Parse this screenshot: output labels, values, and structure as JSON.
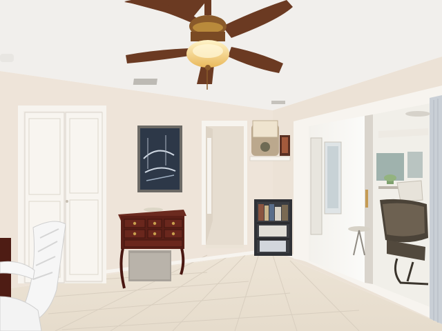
{
  "scene": {
    "subject": "interior-room",
    "elements": [
      "ceiling-fan",
      "closet-bifold-door",
      "framed-artwork",
      "hallway-doorway",
      "wall-shelf-with-basket",
      "small-bookshelf",
      "sliding-glass-door",
      "lanai-patio-chair",
      "dark-wood-dresser",
      "white-office-chair",
      "tile-floor"
    ],
    "colors": {
      "ceiling": "#f1efec",
      "walls": "#efe6dc",
      "floor_tile": "#eee6d9",
      "trim": "#f7f4ef",
      "wood_dark": "#5a1f17",
      "fan_blade": "#6b3a22",
      "fan_light": "#f5d98a",
      "lanai_light": "#f8f7f3"
    }
  }
}
